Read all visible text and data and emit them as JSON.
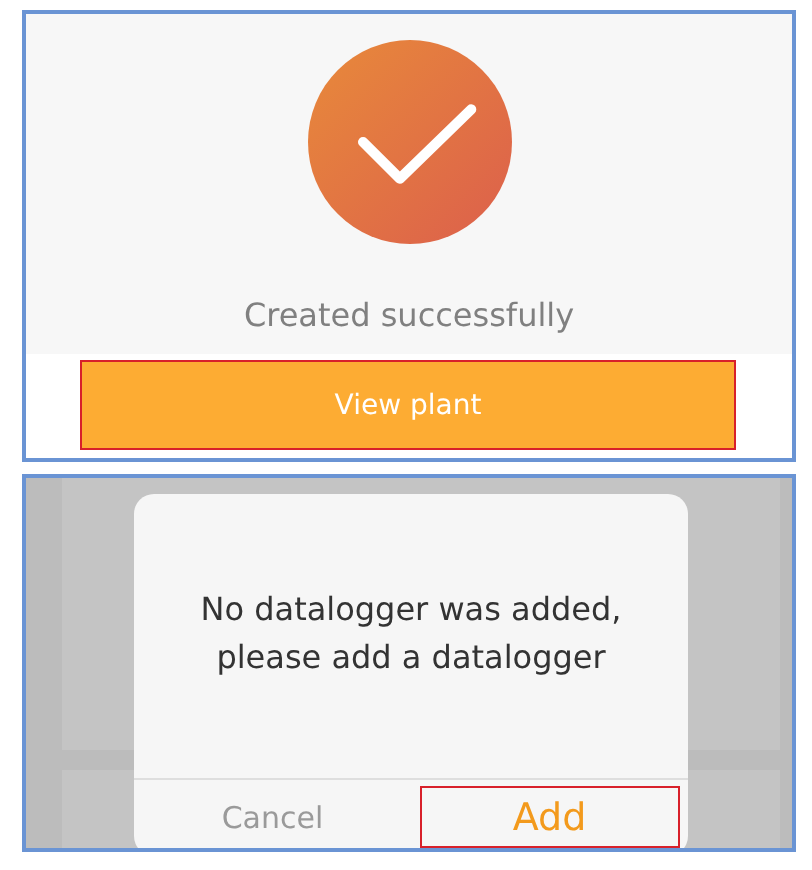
{
  "success_screen": {
    "message": "Created successfully",
    "button": {
      "label": "View plant",
      "highlighted": true
    }
  },
  "dialog": {
    "message": "No datalogger was added,\nplease add a datalogger",
    "buttons": [
      {
        "label": "Cancel",
        "kind": "secondary",
        "highlighted": false
      },
      {
        "label": "Add",
        "kind": "primary",
        "highlighted": true
      }
    ]
  }
}
